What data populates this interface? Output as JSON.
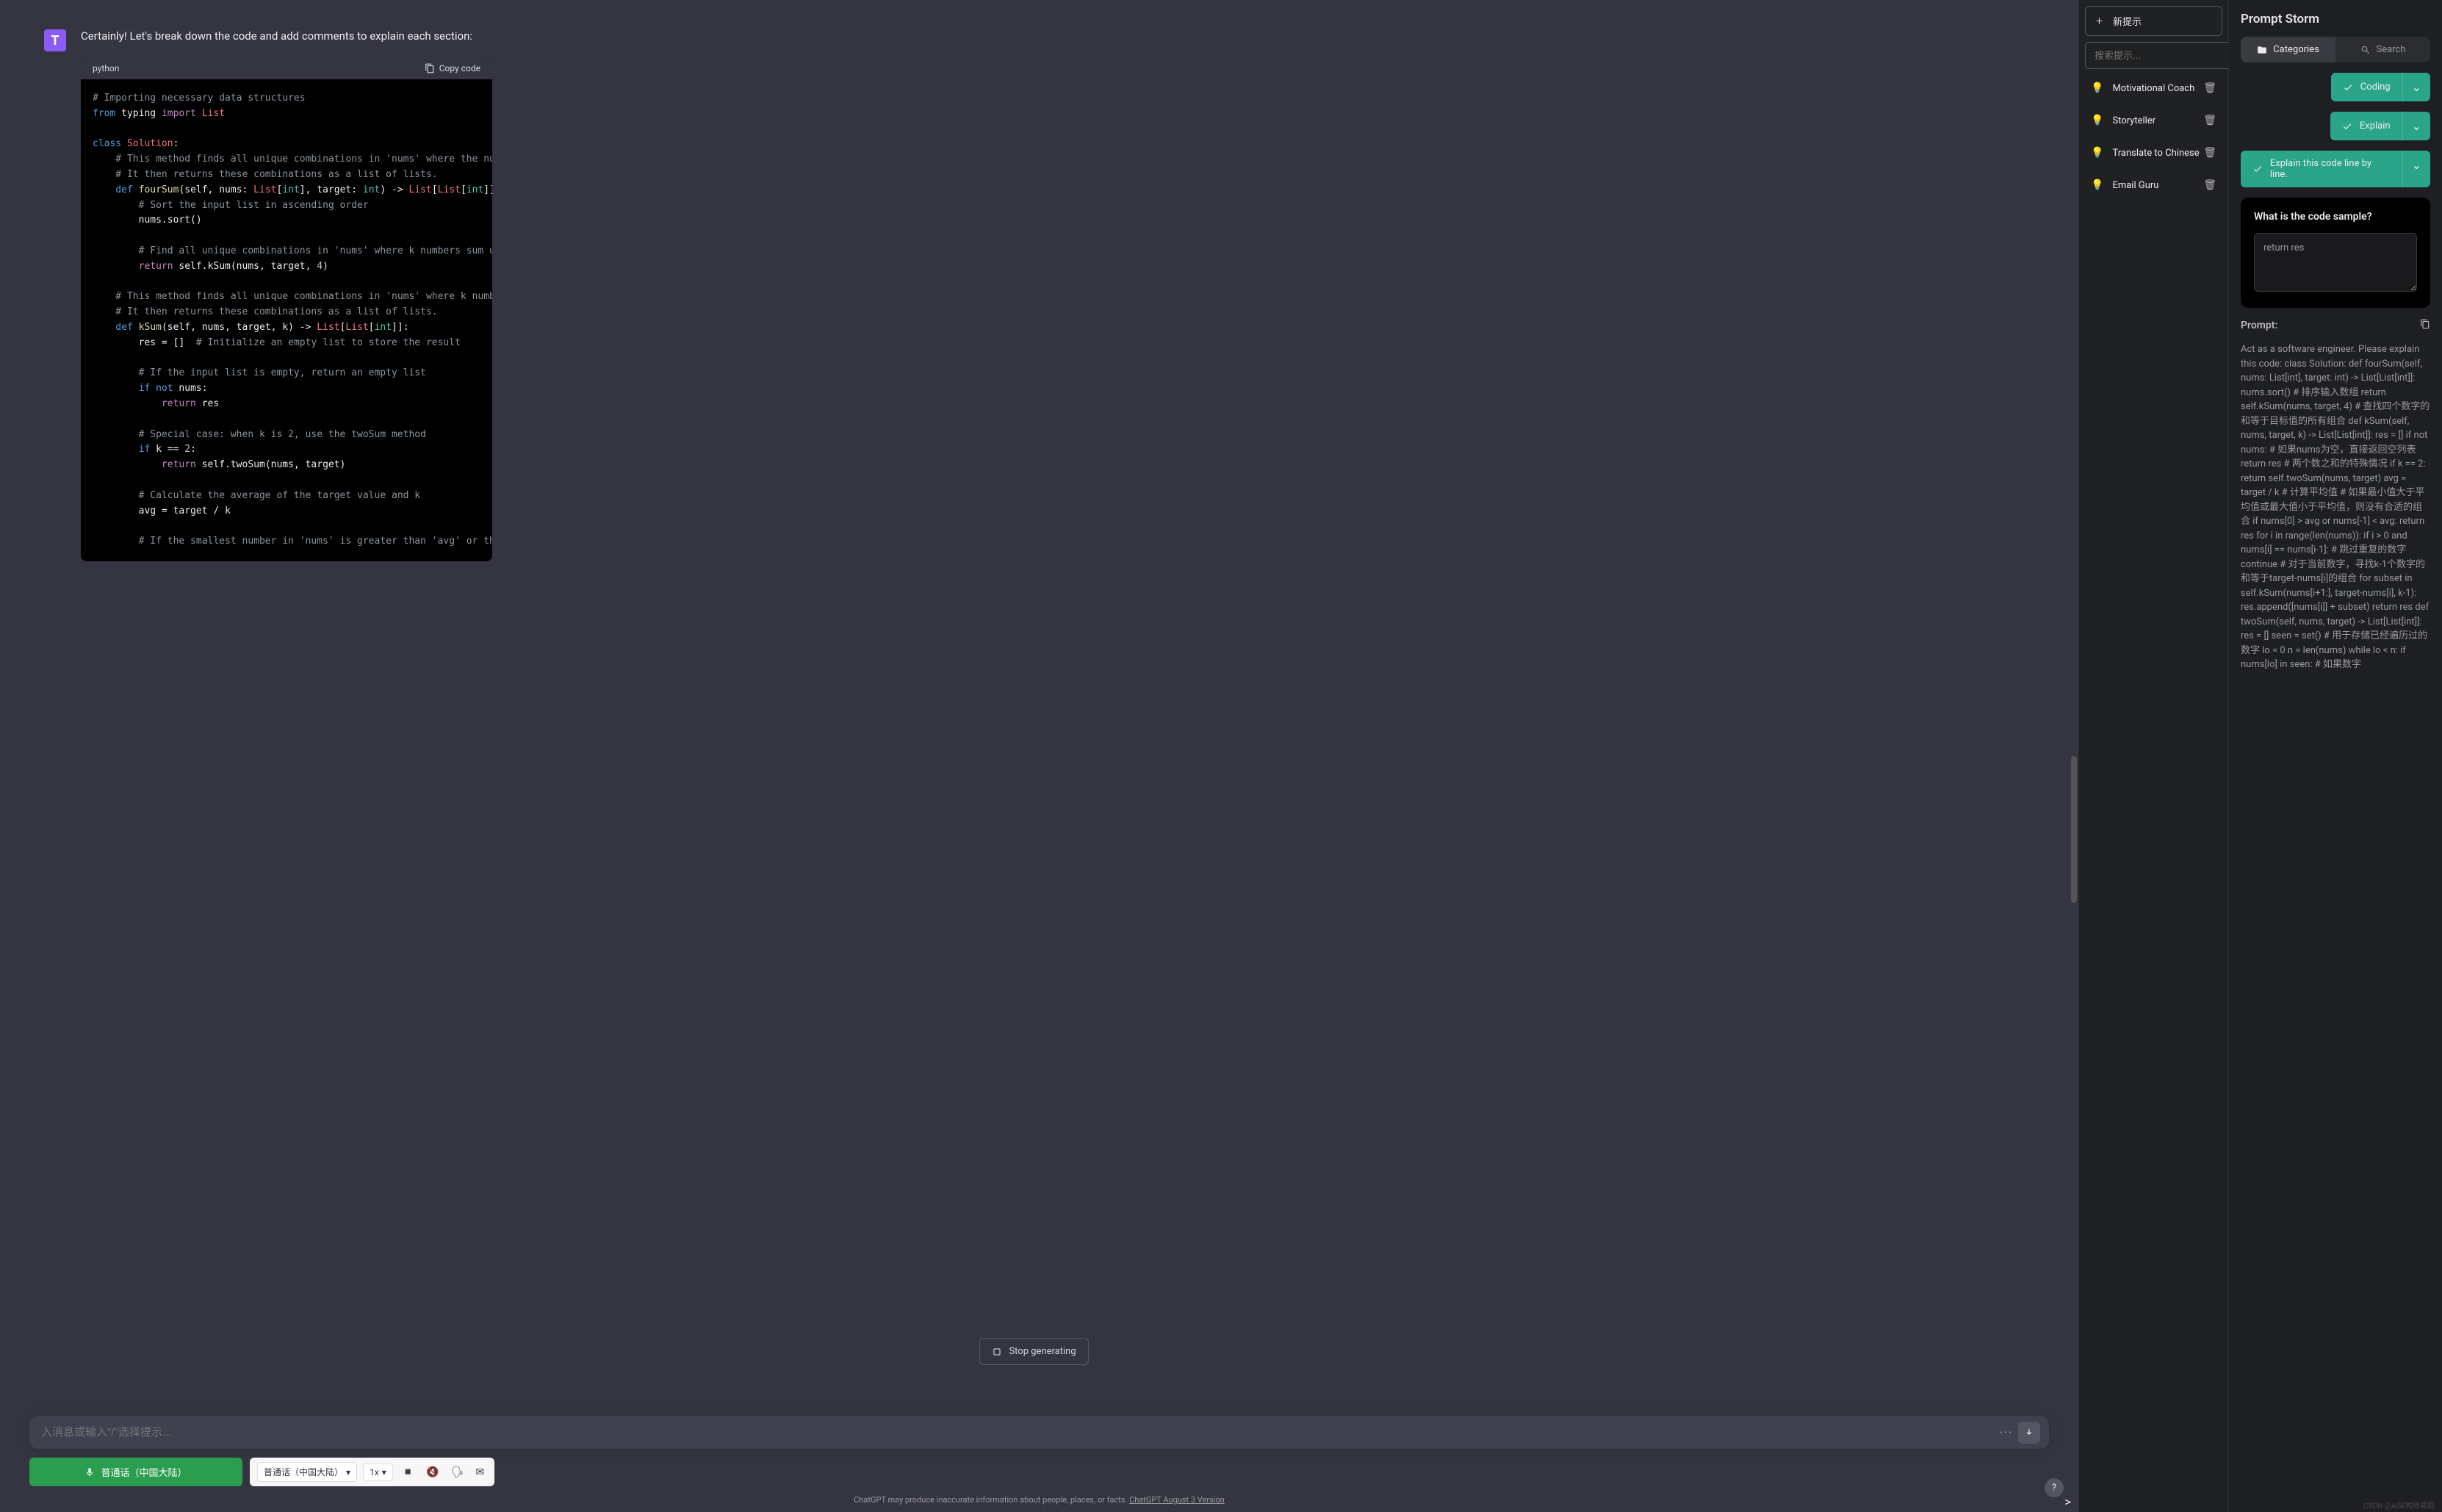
{
  "chat": {
    "avatar_letter": "T",
    "intro": "Certainly! Let's break down the code and add comments to explain each section:",
    "code_lang": "python",
    "copy_label": "Copy code",
    "stop_label": "Stop generating",
    "input_placeholder": "入消息或输入\"/\"选择提示...",
    "mic_label": "普通话（中国大陆）",
    "lang_select": "普通话（中国大陆）",
    "speed": "1x",
    "disclaimer_pre": "ChatGPT may produce inaccurate information about people, places, or facts. ",
    "disclaimer_link": "ChatGPT August 3 Version",
    "help": "?"
  },
  "code": {
    "l1": "# Importing necessary data structures",
    "l2a": "from",
    "l2b": "typing",
    "l2c": "import",
    "l2d": "List",
    "l3a": "class",
    "l3b": "Solution",
    "l3c": ":",
    "l4": "    # This method finds all unique combinations in 'nums' where the numbers ",
    "l5": "    # It then returns these combinations as a list of lists.",
    "l6a": "    def",
    "l6b": "fourSum",
    "l6c": "(self, nums: ",
    "l6d": "List",
    "l6e": "[",
    "l6f": "int",
    "l6g": "], target: ",
    "l6h": "int",
    "l6i": ") -> ",
    "l6j": "List",
    "l6k": "[",
    "l6l": "List",
    "l6m": "[",
    "l6n": "int",
    "l6o": "]]:",
    "l7": "        # Sort the input list in ascending order",
    "l8": "        nums.sort()",
    "l9": "        # Find all unique combinations in 'nums' where k numbers sum up to '",
    "l10a": "        return",
    "l10b": " self.kSum(nums, target, ",
    "l10c": "4",
    "l10d": ")",
    "l11": "    # This method finds all unique combinations in 'nums' where k numbers su",
    "l12": "    # It then returns these combinations as a list of lists.",
    "l13a": "    def",
    "l13b": "kSum",
    "l13c": "(self, nums, target, k) -> ",
    "l13d": "List",
    "l13e": "[",
    "l13f": "List",
    "l13g": "[",
    "l13h": "int",
    "l13i": "]]:",
    "l14a": "        res = []  ",
    "l14b": "# Initialize an empty list to store the result",
    "l15": "        # If the input list is empty, return an empty list",
    "l16a": "        if",
    "l16b": " not",
    "l16c": " nums:",
    "l17a": "            return",
    "l17b": " res",
    "l18": "        # Special case: when k is 2, use the twoSum method",
    "l19a": "        if",
    "l19b": " k == ",
    "l19c": "2",
    "l19d": ":",
    "l20a": "            return",
    "l20b": " self.twoSum(nums, target)",
    "l21": "        # Calculate the average of the target value and k",
    "l22": "        avg = target / k",
    "l23": "        # If the smallest number in 'nums' is greater than 'avg' or the larg"
  },
  "mid": {
    "new_prompt": "新提示",
    "search_placeholder": "搜索提示...",
    "items": [
      {
        "label": "Motivational Coach"
      },
      {
        "label": "Storyteller"
      },
      {
        "label": "Translate to Chinese"
      },
      {
        "label": "Email Guru"
      }
    ]
  },
  "right": {
    "title": "Prompt Storm",
    "categories": "Categories",
    "search": "Search",
    "coding": "Coding",
    "explain": "Explain",
    "explain_line": "Explain this code line by line.",
    "question": "What is the code sample?",
    "textarea_value": "return res",
    "prompt_label": "Prompt:",
    "prompt_body": "Act as a software engineer. Please explain this code: class Solution: def fourSum(self, nums: List[int], target: int) -> List[List[int]]: nums.sort() # 排序输入数组 return self.kSum(nums, target, 4) # 查找四个数字的和等于目标值的所有组合 def kSum(self, nums, target, k) -> List[List[int]]: res = [] if not nums: # 如果nums为空，直接返回空列表 return res # 两个数之和的特殊情况 if k == 2: return self.twoSum(nums, target) avg = target / k # 计算平均值 # 如果最小值大于平均值或最大值小于平均值，则没有合适的组合 if nums[0] > avg or nums[-1] < avg: return res for i in range(len(nums)): if i > 0 and nums[i] == nums[i-1]: # 跳过重复的数字 continue # 对于当前数字，寻找k-1个数字的和等于target-nums[i]的组合 for subset in self.kSum(nums[i+1:], target-nums[i], k-1): res.append([nums[i]] + subset) return res def twoSum(self, nums, target) -> List[List[int]]: res = [] seen = set() # 用于存储已经遍历过的数字 lo = 0 n = len(nums) while lo < n: if nums[lo] in seen: # 如果数字"
  },
  "watermark": "CSDN @AI架构师易筋"
}
